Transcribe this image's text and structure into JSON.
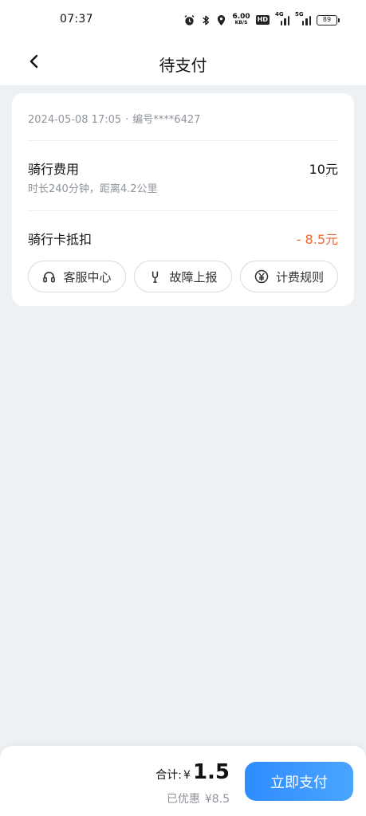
{
  "status_bar": {
    "time": "07:37",
    "net_speed_value": "6.00",
    "net_speed_unit": "KB/S",
    "hd_label": "HD",
    "signal1_label": "4G",
    "signal2_label": "5G",
    "battery": "89",
    "icons": [
      "alarm-icon",
      "bluetooth-icon",
      "location-icon"
    ]
  },
  "header": {
    "title": "待支付",
    "back_icon": "chevron-left-icon"
  },
  "order": {
    "datetime": "2024-05-08 17:05",
    "separator": "·",
    "order_number": "编号****6427"
  },
  "fee": {
    "label": "骑行费用",
    "value": "10元",
    "detail": "时长240分钟，距离4.2公里"
  },
  "discount": {
    "label": "骑行卡抵扣",
    "value": "- 8.5元",
    "color": "#f0662e"
  },
  "actions": [
    {
      "label": "客服中心",
      "icon": "headset-icon"
    },
    {
      "label": "故障上报",
      "icon": "wrench-icon"
    },
    {
      "label": "计费规则",
      "icon": "yen-icon"
    }
  ],
  "footer": {
    "total_label": "合计:",
    "currency": "¥",
    "total_amount": "1.5",
    "saved_label": "已优惠",
    "saved_amount": "¥8.5",
    "pay_button": "立即支付",
    "accent_color": "#2f8cff"
  }
}
